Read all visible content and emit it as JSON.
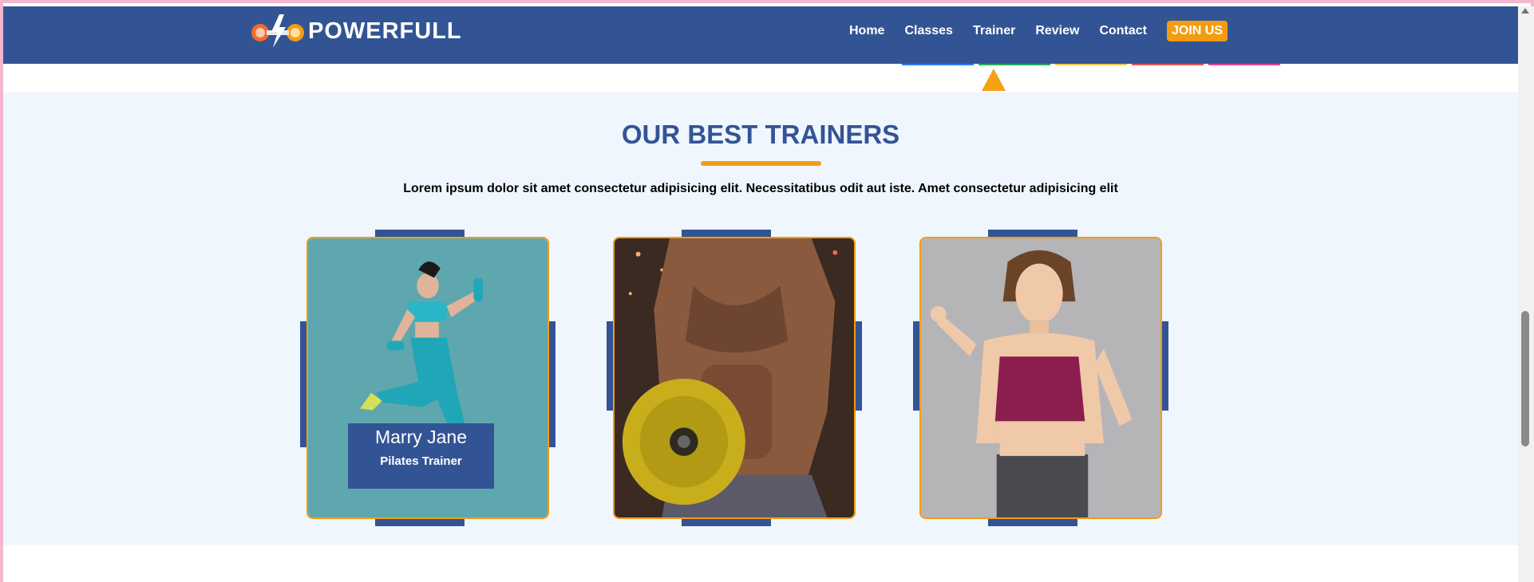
{
  "brand": {
    "name": "POWERFULL"
  },
  "nav": {
    "items": [
      "Home",
      "Classes",
      "Trainer",
      "Review",
      "Contact"
    ],
    "cta": "JOIN US",
    "underline_colors": [
      "#2f80ed",
      "#27ae60",
      "#f2c94c",
      "#eb5757",
      "#e84393"
    ]
  },
  "colors": {
    "primary": "#335494",
    "accent": "#f39c12",
    "section_bg": "#eff6fe"
  },
  "trainers_section": {
    "title": "OUR BEST TRAINERS",
    "subtitle": "Lorem ipsum dolor sit amet consectetur adipisicing elit. Necessitatibus odit aut iste. Amet consectetur adipisicing elit"
  },
  "trainers": [
    {
      "name": "Marry Jane",
      "role": "Pilates Trainer",
      "image": "female-trainer-running-with-dumbbells"
    },
    {
      "image": "muscular-man-holding-weight-plate"
    },
    {
      "image": "smiling-woman-in-sports-bra"
    }
  ]
}
